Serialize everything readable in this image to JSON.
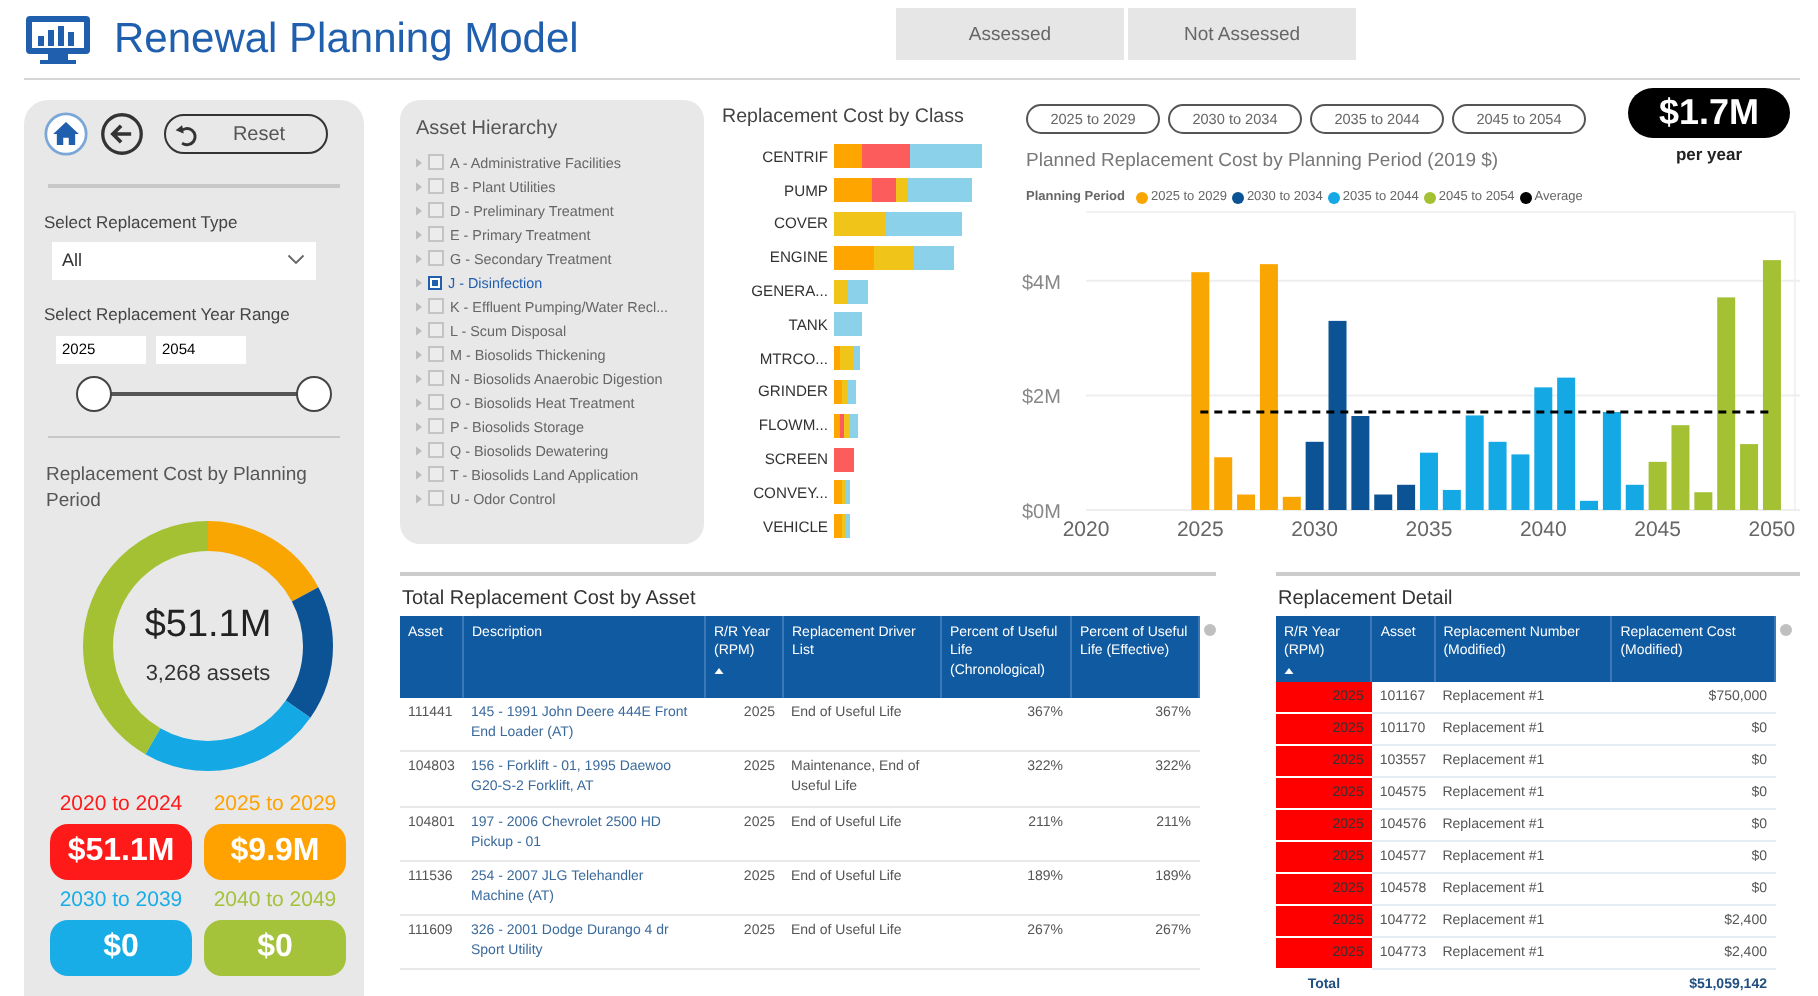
{
  "header": {
    "title": "Renewal Planning Model"
  },
  "assessment_buttons": [
    {
      "label": "Assessed",
      "selected": false
    },
    {
      "label": "Not Assessed",
      "selected": false
    }
  ],
  "filters": {
    "reset_label": "Reset",
    "type_label": "Select Replacement Type",
    "type_value": "All",
    "year_label": "Select Replacement Year Range",
    "year_from": "2025",
    "year_to": "2054"
  },
  "period_summary": {
    "title": "Replacement Cost by Planning Period",
    "total": "$51.1M",
    "assets": "3,268 assets"
  },
  "period_totals": [
    {
      "label": "2020 to 2024",
      "value": "$51.1M",
      "color": "#ff1a1a"
    },
    {
      "label": "2025 to 2029",
      "value": "$9.9M",
      "color": "#ffa200"
    },
    {
      "label": "2030 to 2039",
      "value": "$0",
      "color": "#19ade8"
    },
    {
      "label": "2040 to 2049",
      "value": "$0",
      "color": "#a4c23a"
    }
  ],
  "asset_hierarchy": {
    "title": "Asset Hierarchy",
    "items": [
      {
        "label": "A - Administrative Facilities",
        "checked": false
      },
      {
        "label": "B - Plant Utilities",
        "checked": false
      },
      {
        "label": "D - Preliminary Treatment",
        "checked": false
      },
      {
        "label": "E - Primary Treatment",
        "checked": false
      },
      {
        "label": "G - Secondary Treatment",
        "checked": false
      },
      {
        "label": "J - Disinfection",
        "checked": true
      },
      {
        "label": "K - Effluent Pumping/Water Recl...",
        "checked": false
      },
      {
        "label": "L - Scum Disposal",
        "checked": false
      },
      {
        "label": "M - Biosolids Thickening",
        "checked": false
      },
      {
        "label": "N - Biosolids Anaerobic Digestion",
        "checked": false
      },
      {
        "label": "O - Biosolids Heat Treatment",
        "checked": false
      },
      {
        "label": "P - Biosolids Storage",
        "checked": false
      },
      {
        "label": "Q - Biosolids Dewatering",
        "checked": false
      },
      {
        "label": "T - Biosolids Land Application",
        "checked": false
      },
      {
        "label": "U - Odor Control",
        "checked": false
      }
    ]
  },
  "class_chart": {
    "title": "Replacement Cost by Class",
    "classes": [
      "CENTRIF",
      "PUMP",
      "COVER",
      "ENGINE",
      "GENERA...",
      "TANK",
      "MTRCO...",
      "GRINDER",
      "FLOWM...",
      "SCREEN",
      "CONVEY...",
      "VEHICLE"
    ]
  },
  "period_filters": [
    {
      "label": "2025 to 2029",
      "selected": false
    },
    {
      "label": "2030 to 2034",
      "selected": false
    },
    {
      "label": "2035 to 2044",
      "selected": false
    },
    {
      "label": "2045 to 2054",
      "selected": false
    }
  ],
  "annual_average": {
    "value": "$1.7M",
    "caption": "per year"
  },
  "planned_chart": {
    "chart_data": {
      "type": "bar",
      "title": "Planned Replacement Cost by Planning Period (2019 $)",
      "legend_title": "Planning Period",
      "x": [
        2025,
        2026,
        2027,
        2028,
        2029,
        2030,
        2031,
        2032,
        2033,
        2034,
        2035,
        2036,
        2037,
        2038,
        2039,
        2040,
        2041,
        2042,
        2043,
        2044,
        2045,
        2046,
        2047,
        2048,
        2049,
        2050
      ],
      "xlim": [
        2020,
        2051
      ],
      "ylim": [
        0,
        5.2
      ],
      "xticks": [
        2020,
        2025,
        2030,
        2035,
        2040,
        2045,
        2050
      ],
      "yticks": [
        {
          "value": 0,
          "label": "$0M"
        },
        {
          "value": 2,
          "label": "$2M"
        },
        {
          "value": 4,
          "label": "$4M"
        }
      ],
      "series": [
        {
          "name": "2025 to 2029",
          "color": "#f9a602",
          "values": [
            4.15,
            0.92,
            0.27,
            4.29,
            0.23,
            null,
            null,
            null,
            null,
            null,
            null,
            null,
            null,
            null,
            null,
            null,
            null,
            null,
            null,
            null,
            null,
            null,
            null,
            null,
            null,
            null
          ]
        },
        {
          "name": "2030 to 2034",
          "color": "#0b5394",
          "values": [
            null,
            null,
            null,
            null,
            null,
            1.19,
            3.3,
            1.64,
            0.27,
            0.44,
            null,
            null,
            null,
            null,
            null,
            null,
            null,
            null,
            null,
            null,
            null,
            null,
            null,
            null,
            null,
            null
          ]
        },
        {
          "name": "2035 to 2044",
          "color": "#14a8e4",
          "values": [
            null,
            null,
            null,
            null,
            null,
            null,
            null,
            null,
            null,
            null,
            1.0,
            0.35,
            1.65,
            1.19,
            0.97,
            2.14,
            2.31,
            0.16,
            1.71,
            0.44,
            null,
            null,
            null,
            null,
            null,
            null
          ]
        },
        {
          "name": "2045 to 2054",
          "color": "#a3c132",
          "values": [
            null,
            null,
            null,
            null,
            null,
            null,
            null,
            null,
            null,
            null,
            null,
            null,
            null,
            null,
            null,
            null,
            null,
            null,
            null,
            null,
            0.84,
            1.48,
            0.31,
            3.71,
            1.15,
            4.36
          ]
        },
        {
          "name": "Average",
          "color": "#000000",
          "type": "line",
          "line_style": "dashed",
          "values": [
            1.71,
            1.71,
            1.71,
            1.71,
            1.71,
            1.71,
            1.71,
            1.71,
            1.71,
            1.71,
            1.71,
            1.71,
            1.71,
            1.71,
            1.71,
            1.71,
            1.71,
            1.71,
            1.71,
            1.71,
            1.71,
            1.71,
            1.71,
            1.71,
            1.71,
            1.71
          ]
        }
      ]
    }
  },
  "asset_table": {
    "title": "Total Replacement Cost by Asset",
    "columns": [
      "Asset",
      "Description",
      "R/R Year (RPM)",
      "Replacement Driver List",
      "Percent of Useful Life (Chronological)",
      "Percent of Useful Life (Effective)"
    ],
    "rows": [
      [
        "111441",
        "145 - 1991 John Deere 444E Front End Loader (AT)",
        "2025",
        "End of Useful Life",
        "367%",
        "367%"
      ],
      [
        "104803",
        "156 - Forklift - 01, 1995 Daewoo G20-S-2 Forklift, AT",
        "2025",
        "Maintenance, End of Useful Life",
        "322%",
        "322%"
      ],
      [
        "104801",
        "197 - 2006 Chevrolet 2500 HD Pickup - 01",
        "2025",
        "End of Useful Life",
        "211%",
        "211%"
      ],
      [
        "111536",
        "254 - 2007 JLG Telehandler Machine (AT)",
        "2025",
        "End of Useful Life",
        "189%",
        "189%"
      ],
      [
        "111609",
        "326 - 2001 Dodge Durango 4 dr Sport Utility",
        "2025",
        "End of Useful Life",
        "267%",
        "267%"
      ]
    ]
  },
  "detail_table": {
    "title": "Replacement Detail",
    "columns": [
      "R/R Year (RPM)",
      "Asset",
      "Replacement Number (Modified)",
      "Replacement Cost (Modified)"
    ],
    "rows": [
      [
        "2025",
        "101167",
        "Replacement #1",
        "$750,000"
      ],
      [
        "2025",
        "101170",
        "Replacement #1",
        "$0"
      ],
      [
        "2025",
        "103557",
        "Replacement #1",
        "$0"
      ],
      [
        "2025",
        "104575",
        "Replacement #1",
        "$0"
      ],
      [
        "2025",
        "104576",
        "Replacement #1",
        "$0"
      ],
      [
        "2025",
        "104577",
        "Replacement #1",
        "$0"
      ],
      [
        "2025",
        "104578",
        "Replacement #1",
        "$0"
      ],
      [
        "2025",
        "104772",
        "Replacement #1",
        "$2,400"
      ],
      [
        "2025",
        "104773",
        "Replacement #1",
        "$2,400"
      ]
    ],
    "total_label": "Total",
    "total_value": "$51,059,142"
  }
}
